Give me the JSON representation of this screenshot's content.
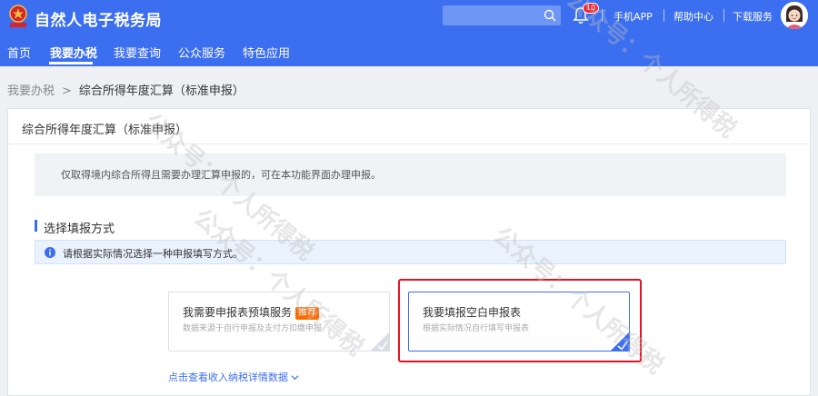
{
  "header": {
    "app_title": "自然人电子税务局",
    "search": {
      "value": "",
      "placeholder": ""
    },
    "notifications_count": "10",
    "links": [
      "手机APP",
      "帮助中心",
      "下载服务"
    ]
  },
  "nav": {
    "items": [
      "首页",
      "我要办税",
      "我要查询",
      "公众服务",
      "特色应用"
    ],
    "active": "我要办税"
  },
  "breadcrumb": {
    "parent": "我要办税",
    "separator": ">",
    "current": "综合所得年度汇算（标准申报）"
  },
  "card": {
    "title": "综合所得年度汇算（标准申报）",
    "notice": "仅取得境内综合所得且需要办理汇算申报的，可在本功能界面办理申报。",
    "section_title": "选择填报方式",
    "info": "请根据实际情况选择一种申报填写方式。",
    "options": [
      {
        "title": "我需要申报表预填服务",
        "badge": "推荐",
        "desc": "数据来源于自行申报及支付方扣缴申报",
        "selected": false
      },
      {
        "title": "我要填报空白申报表",
        "desc": "根据实际情况自行填写申报表",
        "selected": true
      }
    ],
    "detail_link": "点击查看收入纳税详情数据"
  },
  "watermark": "公众号：个人所得税",
  "colors": {
    "primary": "#3c6ef0",
    "highlight": "#e8121f",
    "badge": "#ff6a00",
    "notify": "#f5222d"
  }
}
